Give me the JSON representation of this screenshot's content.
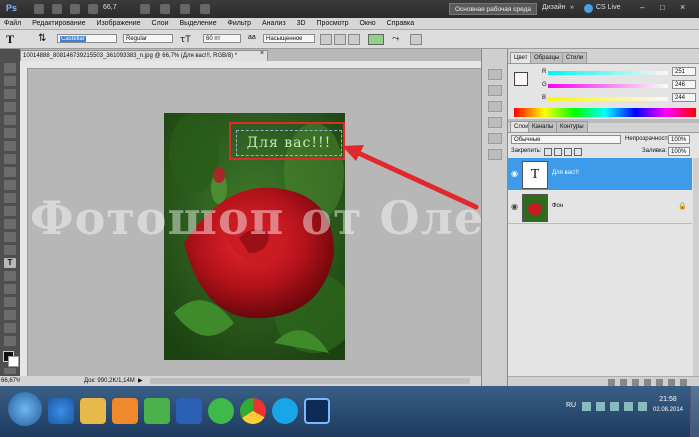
{
  "app": {
    "logo": "Ps",
    "zoom": "66,7",
    "workspace_label": "Основная рабочая среда",
    "design_label": "Дизайн",
    "cslive_label": "CS Live"
  },
  "menu": [
    "Файл",
    "Редактирование",
    "Изображение",
    "Слои",
    "Выделение",
    "Фильтр",
    "Анализ",
    "3D",
    "Просмотр",
    "Окно",
    "Справка"
  ],
  "options": {
    "font_family": "Castellar",
    "font_style": "Regular",
    "font_size": "60 пт",
    "antialias": "Насыщенное"
  },
  "document": {
    "tab_title": "10014888_808146739215503_361093383_n.jpg @ 66,7% (Для вас!!!, RGB/8) *",
    "overlay_text": "Для вас!!!"
  },
  "watermark": "Фотошоп от Олечки",
  "status": {
    "zoom": "66,67%",
    "doc_info": "Док: 990,2K/1,14M"
  },
  "color_panel": {
    "tabs": [
      "Цвет",
      "Образцы",
      "Стили"
    ],
    "r_label": "R",
    "g_label": "G",
    "b_label": "B",
    "r_value": "251",
    "g_value": "246",
    "b_value": "244",
    "fg_color": "#fbf6f4"
  },
  "layers_panel": {
    "tabs": [
      "Слои",
      "Каналы",
      "Контуры"
    ],
    "blend_mode": "Обычные",
    "opacity_label": "Непрозрачность:",
    "opacity_value": "100%",
    "lock_label": "Закрепить:",
    "fill_label": "Заливка:",
    "fill_value": "100%",
    "layers": [
      {
        "name": "Для вас!!!",
        "thumb": "T",
        "selected": true
      },
      {
        "name": "Фон",
        "thumb": "",
        "selected": false
      }
    ]
  },
  "taskbar": {
    "lang": "RU",
    "time": "21:58",
    "date": "02.08.2014"
  },
  "colors": {
    "highlight": "#3d9be9",
    "arrow": "#e3282c"
  }
}
